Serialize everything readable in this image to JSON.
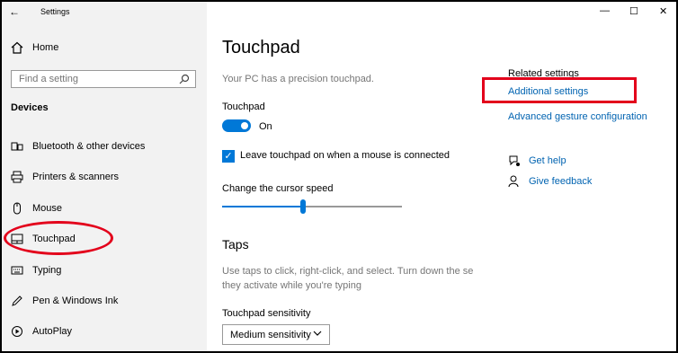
{
  "window": {
    "title": "Settings",
    "back_glyph": "←",
    "minimize_glyph": "—",
    "maximize_glyph": "☐",
    "close_glyph": "✕"
  },
  "sidebar": {
    "home_label": "Home",
    "search_placeholder": "Find a setting",
    "section_heading": "Devices",
    "items": [
      {
        "label": "Bluetooth & other devices",
        "icon": "bluetooth-icon"
      },
      {
        "label": "Printers & scanners",
        "icon": "printer-icon"
      },
      {
        "label": "Mouse",
        "icon": "mouse-icon"
      },
      {
        "label": "Touchpad",
        "icon": "touchpad-icon"
      },
      {
        "label": "Typing",
        "icon": "keyboard-icon"
      },
      {
        "label": "Pen & Windows Ink",
        "icon": "pen-icon"
      },
      {
        "label": "AutoPlay",
        "icon": "autoplay-icon"
      }
    ]
  },
  "main": {
    "title": "Touchpad",
    "status": "Your PC has a precision touchpad.",
    "touchpad_toggle": {
      "label": "Touchpad",
      "state": "On"
    },
    "leave_on_checkbox": {
      "label": "Leave touchpad on when a mouse is connected",
      "checked": true
    },
    "cursor_speed": {
      "label": "Change the cursor speed",
      "value_fraction": 0.45
    },
    "taps": {
      "title": "Taps",
      "description_line1": "Use taps to click, right-click, and select. Turn down the se",
      "description_line2": "they activate while you're typing",
      "sensitivity_label": "Touchpad sensitivity",
      "sensitivity_value": "Medium sensitivity"
    }
  },
  "related": {
    "heading": "Related settings",
    "links": [
      "Additional settings",
      "Advanced gesture configuration"
    ],
    "help": "Get help",
    "feedback": "Give feedback"
  },
  "colors": {
    "accent": "#0078d7",
    "link": "#0063b1",
    "highlight": "#e3001b"
  }
}
